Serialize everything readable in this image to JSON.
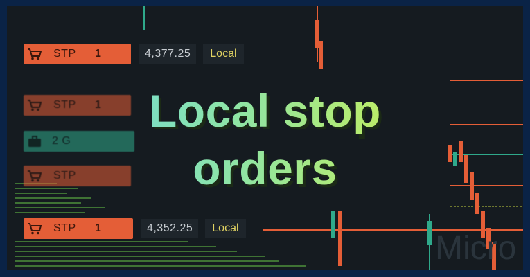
{
  "headline": {
    "line1": "Local stop",
    "line2": "orders"
  },
  "chart": {
    "watermark": "Micro"
  },
  "orders": [
    {
      "type": "STP",
      "qty": "1",
      "price": "4,377.25",
      "scope": "Local"
    },
    {
      "type": "STP",
      "qty": "1"
    },
    {
      "type": "2 G"
    },
    {
      "type": "STP"
    },
    {
      "type": "STP",
      "qty": "1",
      "price": "4,352.25",
      "scope": "Local"
    }
  ],
  "colors": {
    "stop": "#e45e37",
    "group": "#2fa98b",
    "local_text": "#e0d262",
    "headline_start": "#63d6f2",
    "headline_end": "#d6ef4c",
    "frame": "#0a2346"
  },
  "icons": [
    "cart-icon",
    "briefcase-icon"
  ]
}
